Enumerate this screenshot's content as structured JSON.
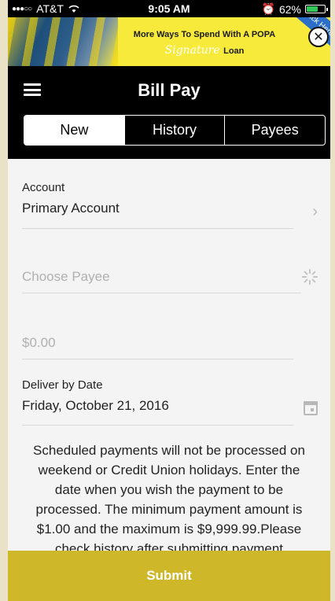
{
  "status_bar": {
    "carrier": "AT&T",
    "time": "9:05 AM",
    "battery": "62%"
  },
  "banner": {
    "line1": "More Ways To Spend With A POPA",
    "line2_script": "Signature",
    "line2_rest": "Loan",
    "corner_text": "Click Here"
  },
  "header": {
    "title": "Bill Pay"
  },
  "tabs": [
    {
      "label": "New",
      "active": true
    },
    {
      "label": "History",
      "active": false
    },
    {
      "label": "Payees",
      "active": false
    }
  ],
  "form": {
    "account_label": "Account",
    "account_value": "Primary Account",
    "payee_placeholder": "Choose Payee",
    "amount_placeholder": "$0.00",
    "deliver_label": "Deliver by Date",
    "deliver_value": "Friday, October 21, 2016"
  },
  "notice": "Scheduled payments will not be processed on weekend or Credit Union holidays. Enter the date when you wish the payment to be processed. The minimum payment amount is $1.00 and the maximum is $9,999.99.Please check history after submitting payment",
  "submit_label": "Submit",
  "colors": {
    "accent": "#cfb72a",
    "navbar": "#000000",
    "battery": "#34c759"
  }
}
